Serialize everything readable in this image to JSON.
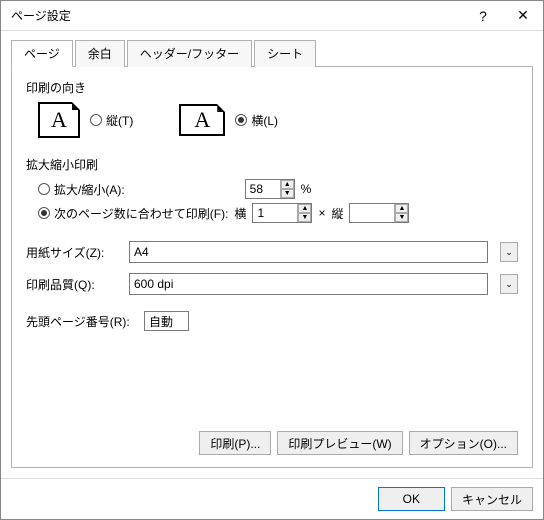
{
  "title": "ページ設定",
  "tabs": {
    "page": "ページ",
    "margins": "余白",
    "headerfooter": "ヘッダー/フッター",
    "sheet": "シート"
  },
  "orientation": {
    "label": "印刷の向き",
    "portrait": "縦(T)",
    "landscape": "横(L)",
    "selected": "landscape"
  },
  "scaling": {
    "label": "拡大縮小印刷",
    "adjust": "拡大/縮小(A):",
    "adjust_value": "58",
    "adjust_unit": "%",
    "fit": "次のページ数に合わせて印刷(F):",
    "wide_label": "横",
    "wide_value": "1",
    "times": "×",
    "tall_label": "縦",
    "tall_value": "",
    "selected": "fit"
  },
  "paper": {
    "label": "用紙サイズ(Z):",
    "value": "A4"
  },
  "quality": {
    "label": "印刷品質(Q):",
    "value": "600 dpi"
  },
  "firstpage": {
    "label": "先頭ページ番号(R):",
    "value": "自動"
  },
  "buttons": {
    "print": "印刷(P)...",
    "preview": "印刷プレビュー(W)",
    "options": "オプション(O)...",
    "ok": "OK",
    "cancel": "キャンセル"
  }
}
